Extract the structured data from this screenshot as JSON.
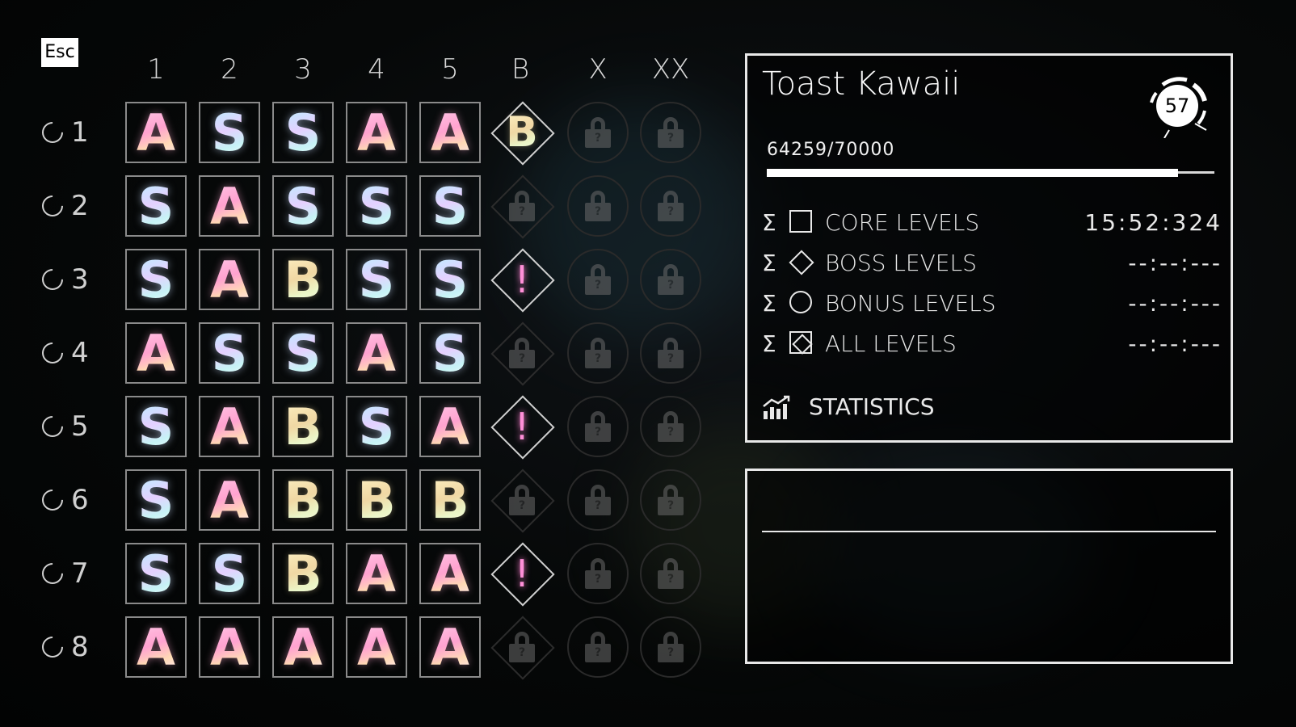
{
  "esc_label": "Esc",
  "columns": [
    "1",
    "2",
    "3",
    "4",
    "5",
    "B",
    "X",
    "XX"
  ],
  "rows": [
    {
      "label": "1",
      "grades": [
        "A",
        "S",
        "S",
        "A",
        "A"
      ],
      "boss": {
        "state": "grade",
        "text": "B"
      },
      "x": "locked",
      "xx": "locked"
    },
    {
      "label": "2",
      "grades": [
        "S",
        "A",
        "S",
        "S",
        "S"
      ],
      "boss": {
        "state": "locked",
        "text": ""
      },
      "x": "locked",
      "xx": "locked"
    },
    {
      "label": "3",
      "grades": [
        "S",
        "A",
        "B",
        "S",
        "S"
      ],
      "boss": {
        "state": "unlocked",
        "text": "!"
      },
      "x": "locked",
      "xx": "locked"
    },
    {
      "label": "4",
      "grades": [
        "A",
        "S",
        "S",
        "A",
        "S"
      ],
      "boss": {
        "state": "locked",
        "text": ""
      },
      "x": "locked",
      "xx": "locked"
    },
    {
      "label": "5",
      "grades": [
        "S",
        "A",
        "B",
        "S",
        "A"
      ],
      "boss": {
        "state": "unlocked",
        "text": "!"
      },
      "x": "locked",
      "xx": "locked"
    },
    {
      "label": "6",
      "grades": [
        "S",
        "A",
        "B",
        "B",
        "B"
      ],
      "boss": {
        "state": "locked",
        "text": ""
      },
      "x": "locked",
      "xx": "locked"
    },
    {
      "label": "7",
      "grades": [
        "S",
        "S",
        "B",
        "A",
        "A"
      ],
      "boss": {
        "state": "unlocked",
        "text": "!"
      },
      "x": "locked",
      "xx": "locked"
    },
    {
      "label": "8",
      "grades": [
        "A",
        "A",
        "A",
        "A",
        "A"
      ],
      "boss": {
        "state": "locked",
        "text": ""
      },
      "x": "locked",
      "xx": "locked"
    }
  ],
  "lock_glyph": "?",
  "profile": {
    "name": "Toast Kawaii",
    "level": "57",
    "score_text": "64259/70000",
    "progress_fraction": 0.918
  },
  "summary": [
    {
      "sigma": "Σ",
      "symbol": "square",
      "label": "CORE LEVELS",
      "time": "15:52:324"
    },
    {
      "sigma": "Σ",
      "symbol": "diamond",
      "label": "BOSS LEVELS",
      "time": "--:--:---"
    },
    {
      "sigma": "Σ",
      "symbol": "circle",
      "label": "BONUS LEVELS",
      "time": "--:--:---"
    },
    {
      "sigma": "Σ",
      "symbol": "all",
      "label": "ALL LEVELS",
      "time": "--:--:---"
    }
  ],
  "statistics_label": "STATISTICS",
  "colors": {
    "accent_pink": "#ff8fd8",
    "panel_border": "#e8e8e8"
  }
}
